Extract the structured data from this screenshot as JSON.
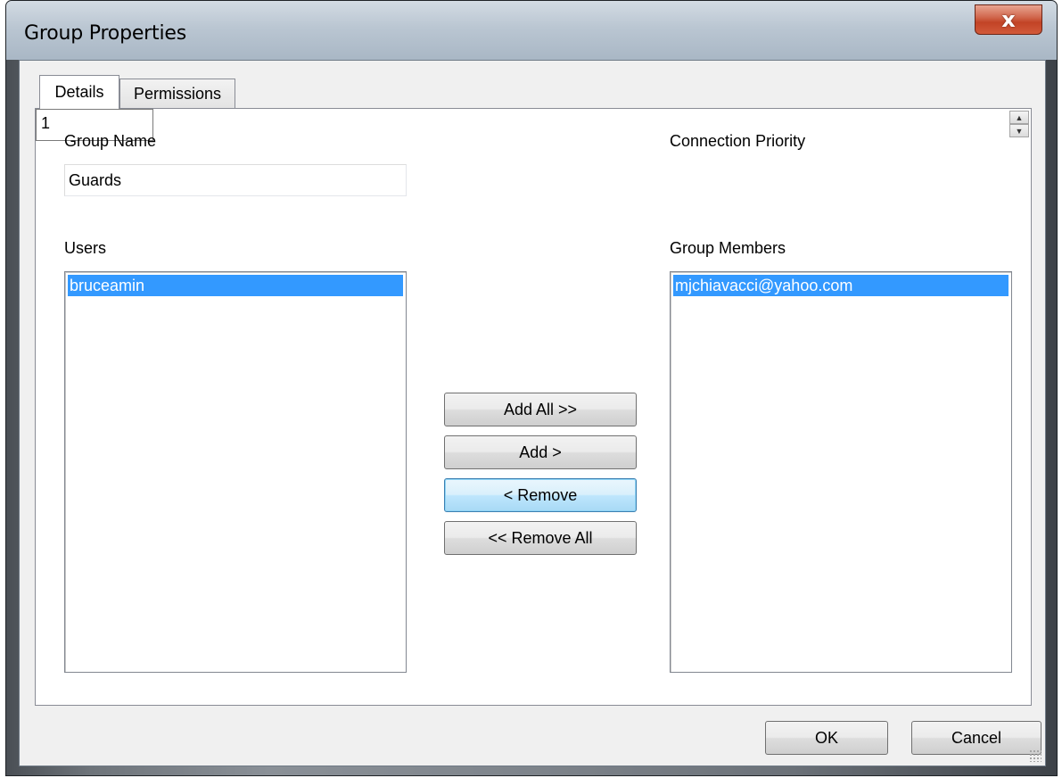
{
  "window": {
    "title": "Group Properties",
    "close_label": "x"
  },
  "tabs": [
    {
      "label": "Details",
      "active": true
    },
    {
      "label": "Permissions",
      "active": false
    }
  ],
  "details": {
    "group_name_label": "Group Name",
    "group_name_value": "Guards",
    "connection_priority_label": "Connection Priority",
    "connection_priority_value": "1",
    "users_label": "Users",
    "users": [
      "bruceamin"
    ],
    "group_members_label": "Group Members",
    "group_members": [
      "mjchiavacci@yahoo.com"
    ]
  },
  "buttons": {
    "add_all": "Add All >>",
    "add": "Add >",
    "remove": "< Remove",
    "remove_all": "<< Remove All",
    "ok": "OK",
    "cancel": "Cancel"
  },
  "colors": {
    "selection": "#3399ff",
    "close_button": "#c24326"
  },
  "icons": {
    "close": "close-icon",
    "spin_up": "arrow-up-icon",
    "spin_down": "arrow-down-icon",
    "grip": "resize-grip-icon"
  }
}
